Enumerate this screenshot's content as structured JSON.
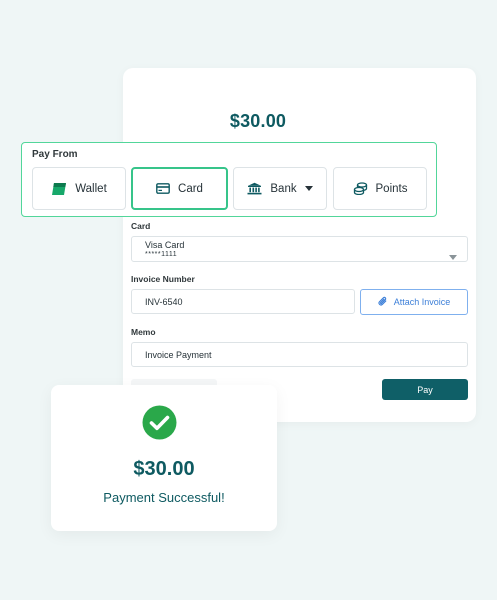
{
  "payment": {
    "amount": "$30.00"
  },
  "pay_from": {
    "label": "Pay From",
    "methods": [
      {
        "label": "Wallet",
        "icon": "wallet-icon"
      },
      {
        "label": "Card",
        "icon": "credit-card-icon",
        "selected": true
      },
      {
        "label": "Bank",
        "icon": "bank-icon"
      },
      {
        "label": "Points",
        "icon": "coins-icon"
      }
    ]
  },
  "form": {
    "card_label": "Card",
    "card_name": "Visa Card",
    "card_number": "*****1111",
    "invoice_label": "Invoice Number",
    "invoice_value": "INV-6540",
    "attach_label": "Attach Invoice",
    "memo_label": "Memo",
    "memo_value": "Invoice Payment",
    "pay_label": "Pay"
  },
  "success": {
    "amount": "$30.00",
    "message": "Payment Successful!"
  },
  "colors": {
    "brand": "#0e5a61",
    "accent_green": "#36c48a",
    "link_blue": "#3c7fd8"
  }
}
